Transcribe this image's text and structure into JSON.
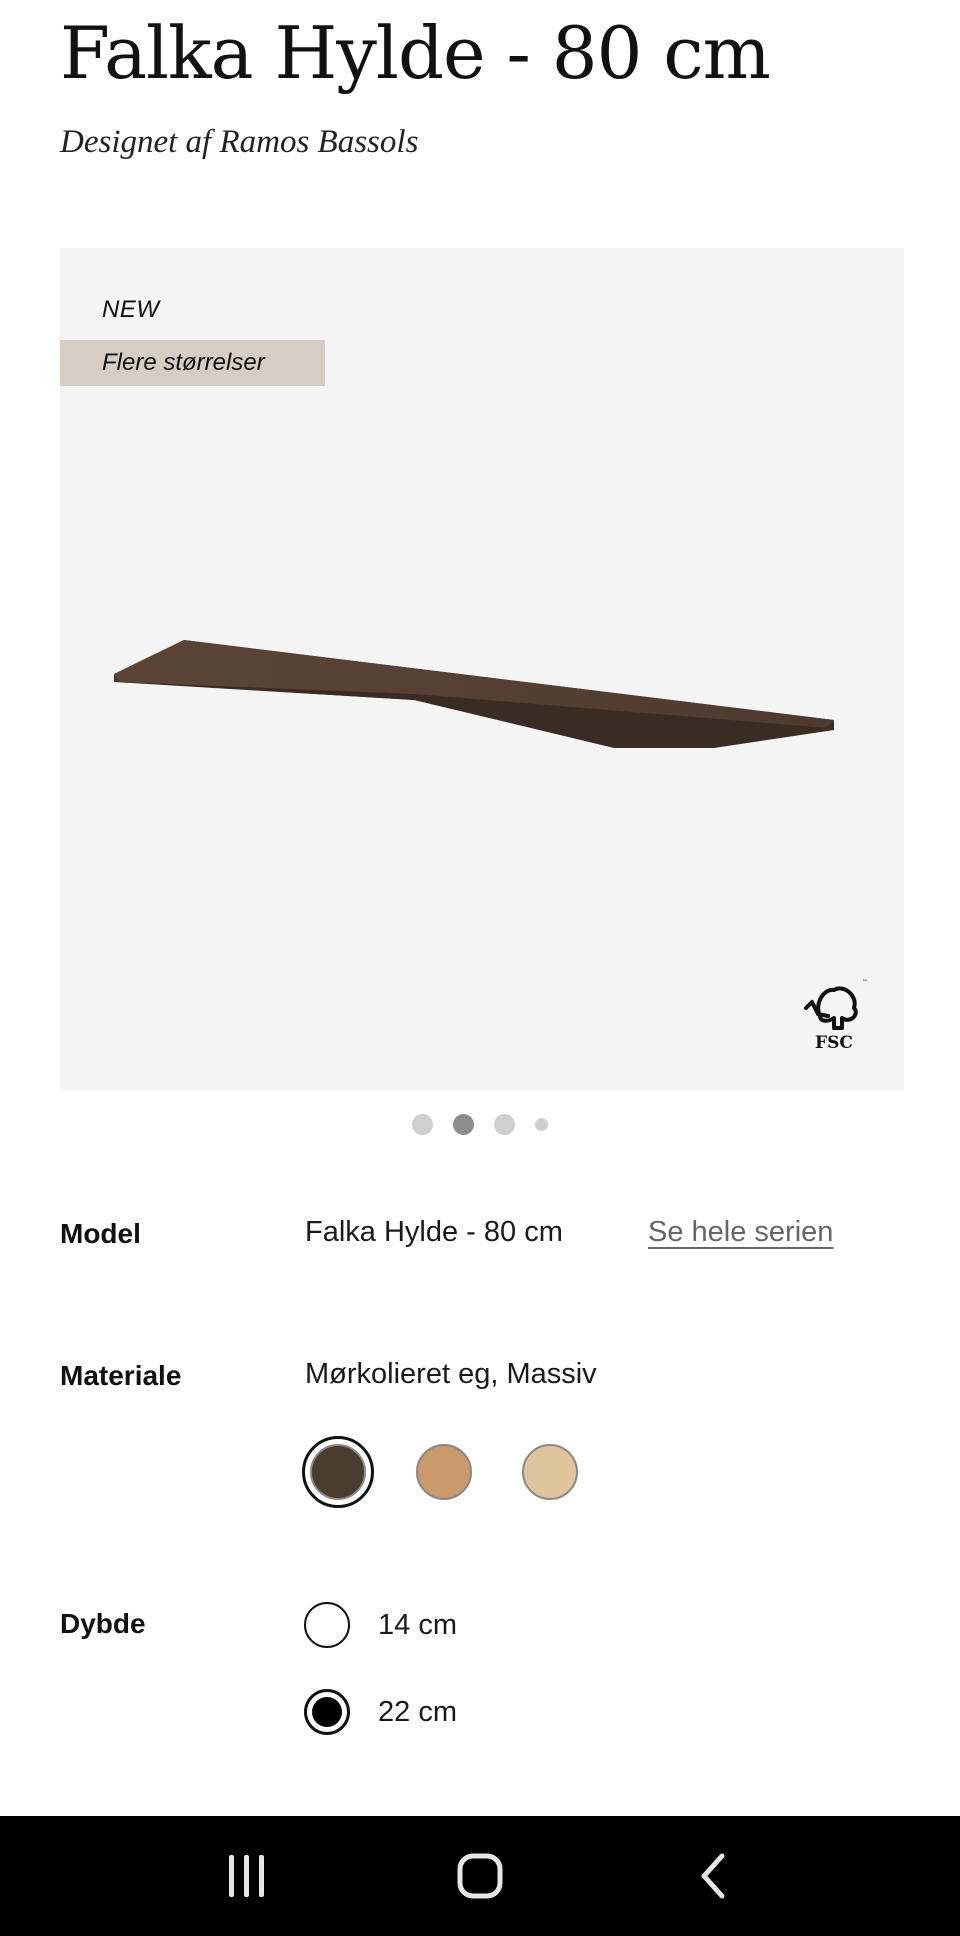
{
  "product": {
    "title": "Falka Hylde - 80 cm",
    "designer": "Designet af Ramos Bassols"
  },
  "hero": {
    "badge_new": "NEW",
    "badge_sizes": "Flere størrelser",
    "background": "#f4f4f4",
    "fsc_label": "FSC",
    "carousel_dots": 4,
    "active_dot": 2
  },
  "model": {
    "label": "Model",
    "value": "Falka Hylde - 80 cm",
    "series_link": "Se hele serien"
  },
  "material": {
    "label": "Materiale",
    "value": "Mørkolieret eg, Massiv",
    "swatches": [
      {
        "name": "dark-oiled-oak",
        "color": "#4a3d30",
        "selected": true
      },
      {
        "name": "oiled-oak",
        "color": "#c99a6a",
        "selected": false
      },
      {
        "name": "light-oak",
        "color": "#e0c59c",
        "selected": false
      }
    ]
  },
  "depth": {
    "label": "Dybde",
    "options": [
      {
        "label": "14 cm",
        "checked": false
      },
      {
        "label": "22 cm",
        "checked": true
      }
    ]
  },
  "system_nav": {
    "recent_apps": "recent-apps-icon",
    "home": "home-icon",
    "back": "back-icon"
  }
}
